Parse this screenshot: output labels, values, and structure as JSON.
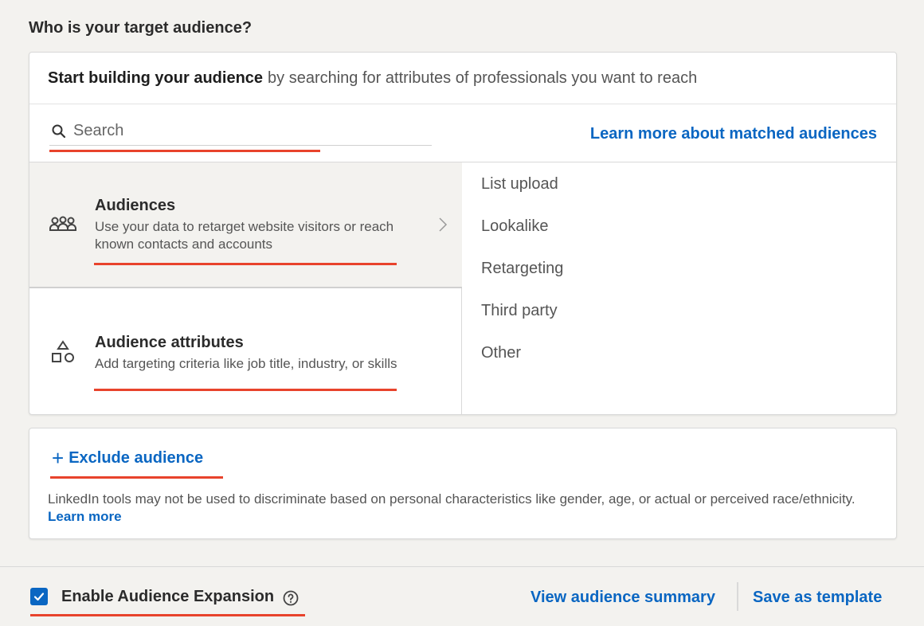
{
  "question": "Who is your target audience?",
  "card": {
    "header_bold": "Start building your audience",
    "header_rest": "by searching for attributes of professionals you want to reach",
    "search_placeholder": "Search",
    "learn_matched": "Learn more about matched audiences"
  },
  "categories": [
    {
      "title": "Audiences",
      "desc": "Use your data to retarget website visitors or reach known contacts and accounts",
      "icon": "group-icon"
    },
    {
      "title": "Audience attributes",
      "desc": "Add targeting criteria like job title, industry, or skills",
      "icon": "shapes-icon"
    }
  ],
  "audience_options": [
    "List upload",
    "Lookalike",
    "Retargeting",
    "Third party",
    "Other"
  ],
  "exclude": {
    "label": "Exclude audience",
    "disclaimer": "LinkedIn tools may not be used to discriminate based on personal characteristics like gender, age, or actual or perceived race/ethnicity.",
    "learn_more": "Learn more"
  },
  "footer": {
    "expansion_label": "Enable Audience Expansion",
    "expansion_checked": true,
    "view_summary": "View audience summary",
    "save_template": "Save as template"
  },
  "colors": {
    "accent": "#0a66c2",
    "annotation": "#e8432c"
  }
}
